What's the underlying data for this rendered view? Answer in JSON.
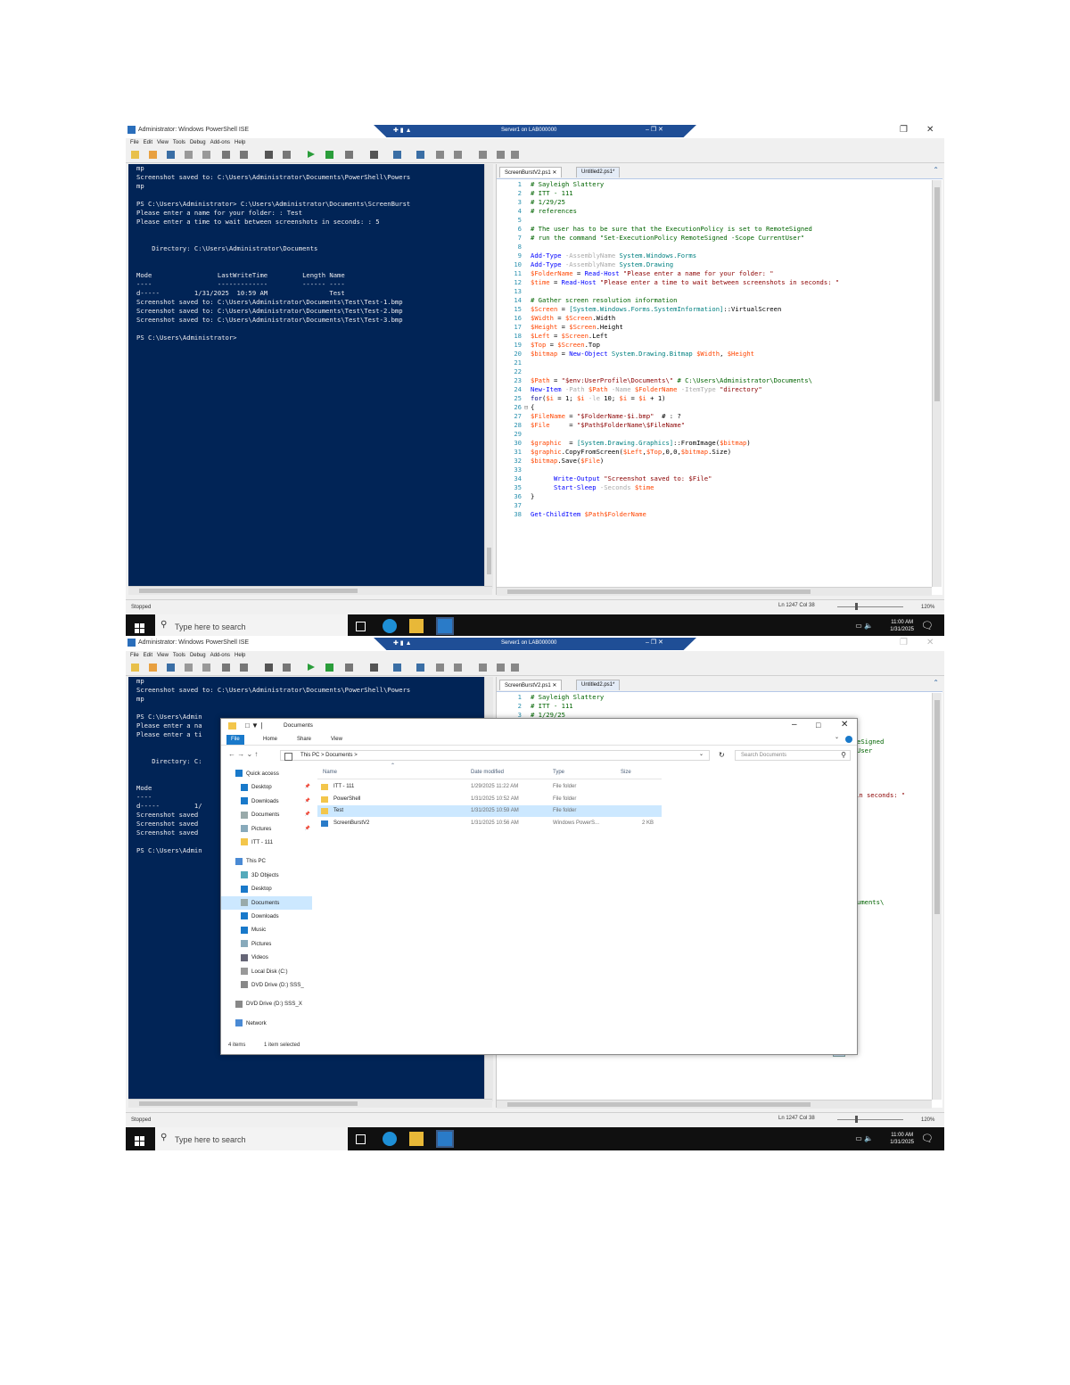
{
  "window": {
    "title": "Administrator: Windows PowerShell ISE",
    "menu": [
      "File",
      "Edit",
      "View",
      "Tools",
      "Debug",
      "Add-ons",
      "Help"
    ]
  },
  "rdp_bar": {
    "server": "Server1 on LAB000000"
  },
  "console_lines_top": [
    "mp",
    "Screenshot saved to: C:\\Users\\Administrator\\Documents\\PowerShell\\Powers",
    "mp",
    "",
    "PS C:\\Users\\Administrator> C:\\Users\\Administrator\\Documents\\ScreenBurst",
    "Please enter a name for your folder: : Test",
    "Please enter a time to wait between screenshots in seconds: : 5",
    "",
    "",
    "    Directory: C:\\Users\\Administrator\\Documents",
    "",
    "",
    "Mode                 LastWriteTime         Length Name",
    "----                 -------------         ------ ----",
    "d-----         1/31/2025  10:59 AM                Test",
    "Screenshot saved to: C:\\Users\\Administrator\\Documents\\Test\\Test-1.bmp",
    "Screenshot saved to: C:\\Users\\Administrator\\Documents\\Test\\Test-2.bmp",
    "Screenshot saved to: C:\\Users\\Administrator\\Documents\\Test\\Test-3.bmp",
    "",
    "PS C:\\Users\\Administrator>"
  ],
  "console_lines_bottom": [
    "mp",
    "Screenshot saved to: C:\\Users\\Administrator\\Documents\\PowerShell\\Powers",
    "mp",
    "",
    "PS C:\\Users\\Admin",
    "Please enter a na",
    "Please enter a ti",
    "",
    "",
    "    Directory: C:",
    "",
    "",
    "Mode",
    "----",
    "d-----         1/",
    "Screenshot saved",
    "Screenshot saved",
    "Screenshot saved",
    "",
    "PS C:\\Users\\Admin"
  ],
  "editor": {
    "tabs": [
      "ScreenBurstV2.ps1",
      "Untitled2.ps1*"
    ],
    "lines": [
      {
        "n": "1",
        "tokens": [
          [
            "c",
            "# Sayleigh Slattery"
          ]
        ]
      },
      {
        "n": "2",
        "tokens": [
          [
            "c",
            "# ITT - 111"
          ]
        ]
      },
      {
        "n": "3",
        "tokens": [
          [
            "c",
            "# 1/29/25"
          ]
        ]
      },
      {
        "n": "4",
        "tokens": [
          [
            "c",
            "# references"
          ]
        ]
      },
      {
        "n": "5",
        "tokens": []
      },
      {
        "n": "6",
        "tokens": [
          [
            "c",
            "# The user has to be sure that the ExecutionPolicy is set to RemoteSigned"
          ]
        ]
      },
      {
        "n": "7",
        "tokens": [
          [
            "c",
            "# run the command \"Set-ExecutionPolicy RemoteSigned -Scope CurrentUser\""
          ]
        ]
      },
      {
        "n": "8",
        "tokens": []
      },
      {
        "n": "9",
        "tokens": [
          [
            "k",
            "Add-Type"
          ],
          [
            "p",
            " "
          ],
          [
            "o",
            "-AssemblyName"
          ],
          [
            "p",
            " "
          ],
          [
            "t",
            "System.Windows.Forms"
          ]
        ]
      },
      {
        "n": "10",
        "tokens": [
          [
            "k",
            "Add-Type"
          ],
          [
            "p",
            " "
          ],
          [
            "o",
            "-AssemblyName"
          ],
          [
            "p",
            " "
          ],
          [
            "t",
            "System.Drawing"
          ]
        ]
      },
      {
        "n": "11",
        "tokens": [
          [
            "v",
            "$FolderName"
          ],
          [
            "p",
            " = "
          ],
          [
            "k",
            "Read-Host"
          ],
          [
            "p",
            " "
          ],
          [
            "s",
            "\"Please enter a name for your folder: \""
          ]
        ]
      },
      {
        "n": "12",
        "tokens": [
          [
            "v",
            "$time"
          ],
          [
            "p",
            " = "
          ],
          [
            "k",
            "Read-Host"
          ],
          [
            "p",
            " "
          ],
          [
            "s",
            "\"Please enter a time to wait between screenshots in seconds: \""
          ]
        ]
      },
      {
        "n": "13",
        "tokens": []
      },
      {
        "n": "14",
        "tokens": [
          [
            "c",
            "# Gather screen resolution information"
          ]
        ]
      },
      {
        "n": "15",
        "tokens": [
          [
            "v",
            "$Screen"
          ],
          [
            "p",
            " = "
          ],
          [
            "t",
            "[System.Windows.Forms.SystemInformation]"
          ],
          [
            "p",
            "::VirtualScreen"
          ]
        ]
      },
      {
        "n": "16",
        "tokens": [
          [
            "v",
            "$Width"
          ],
          [
            "p",
            " = "
          ],
          [
            "v",
            "$Screen"
          ],
          [
            "p",
            ".Width"
          ]
        ]
      },
      {
        "n": "17",
        "tokens": [
          [
            "v",
            "$Height"
          ],
          [
            "p",
            " = "
          ],
          [
            "v",
            "$Screen"
          ],
          [
            "p",
            ".Height"
          ]
        ]
      },
      {
        "n": "18",
        "tokens": [
          [
            "v",
            "$Left"
          ],
          [
            "p",
            " = "
          ],
          [
            "v",
            "$Screen"
          ],
          [
            "p",
            ".Left"
          ]
        ]
      },
      {
        "n": "19",
        "tokens": [
          [
            "v",
            "$Top"
          ],
          [
            "p",
            " = "
          ],
          [
            "v",
            "$Screen"
          ],
          [
            "p",
            ".Top"
          ]
        ]
      },
      {
        "n": "20",
        "tokens": [
          [
            "v",
            "$bitmap"
          ],
          [
            "p",
            " = "
          ],
          [
            "k",
            "New-Object"
          ],
          [
            "p",
            " "
          ],
          [
            "t",
            "System.Drawing.Bitmap"
          ],
          [
            "p",
            " "
          ],
          [
            "v",
            "$Width"
          ],
          [
            "p",
            ", "
          ],
          [
            "v",
            "$Height"
          ]
        ]
      },
      {
        "n": "21",
        "tokens": []
      },
      {
        "n": "22",
        "tokens": []
      },
      {
        "n": "23",
        "tokens": [
          [
            "v",
            "$Path"
          ],
          [
            "p",
            " = "
          ],
          [
            "s",
            "\"$env:UserProfile\\Documents\\\""
          ],
          [
            "p",
            " "
          ],
          [
            "c",
            "# C:\\Users\\Administrator\\Documents\\"
          ]
        ]
      },
      {
        "n": "24",
        "tokens": [
          [
            "k",
            "New-Item"
          ],
          [
            "p",
            " "
          ],
          [
            "o",
            "-Path"
          ],
          [
            "p",
            " "
          ],
          [
            "v",
            "$Path"
          ],
          [
            "p",
            " "
          ],
          [
            "o",
            "-Name"
          ],
          [
            "p",
            " "
          ],
          [
            "v",
            "$FolderName"
          ],
          [
            "p",
            " "
          ],
          [
            "o",
            "-ItemType"
          ],
          [
            "p",
            " "
          ],
          [
            "s",
            "\"directory\""
          ]
        ]
      },
      {
        "n": "25",
        "tokens": [
          [
            "w",
            "for"
          ],
          [
            "p",
            "("
          ],
          [
            "v",
            "$i"
          ],
          [
            "p",
            " = 1; "
          ],
          [
            "v",
            "$i"
          ],
          [
            "p",
            " "
          ],
          [
            "o",
            "-le"
          ],
          [
            "p",
            " 10; "
          ],
          [
            "v",
            "$i"
          ],
          [
            "p",
            " = "
          ],
          [
            "v",
            "$i"
          ],
          [
            "p",
            " + 1)"
          ]
        ]
      },
      {
        "n": "26",
        "tokens": [
          [
            "p",
            "{"
          ]
        ],
        "fold": true
      },
      {
        "n": "27",
        "tokens": [
          [
            "v",
            "$FileName"
          ],
          [
            "p",
            " = "
          ],
          [
            "s",
            "\"$FolderName-$i.bmp\""
          ],
          [
            "p",
            "  # : ?"
          ]
        ]
      },
      {
        "n": "28",
        "tokens": [
          [
            "v",
            "$File"
          ],
          [
            "p",
            "     = "
          ],
          [
            "s",
            "\"$Path$FolderName\\$FileName\""
          ]
        ]
      },
      {
        "n": "29",
        "tokens": []
      },
      {
        "n": "30",
        "tokens": [
          [
            "v",
            "$graphic"
          ],
          [
            "p",
            "  = "
          ],
          [
            "t",
            "[System.Drawing.Graphics]"
          ],
          [
            "p",
            "::FromImage("
          ],
          [
            "v",
            "$bitmap"
          ],
          [
            "p",
            ")"
          ]
        ]
      },
      {
        "n": "31",
        "tokens": [
          [
            "v",
            "$graphic"
          ],
          [
            "p",
            ".CopyFromScreen("
          ],
          [
            "v",
            "$Left"
          ],
          [
            "p",
            ","
          ],
          [
            "v",
            "$Top"
          ],
          [
            "p",
            ",0,0,"
          ],
          [
            "v",
            "$bitmap"
          ],
          [
            "p",
            ".Size)"
          ]
        ]
      },
      {
        "n": "32",
        "tokens": [
          [
            "v",
            "$bitmap"
          ],
          [
            "p",
            ".Save("
          ],
          [
            "v",
            "$File"
          ],
          [
            "p",
            ")"
          ]
        ]
      },
      {
        "n": "33",
        "tokens": []
      },
      {
        "n": "34",
        "tokens": [
          [
            "p",
            "      "
          ],
          [
            "k",
            "Write-Output"
          ],
          [
            "p",
            " "
          ],
          [
            "s",
            "\"Screenshot saved to: $File\""
          ]
        ]
      },
      {
        "n": "35",
        "tokens": [
          [
            "p",
            "      "
          ],
          [
            "k",
            "Start-Sleep"
          ],
          [
            "p",
            " "
          ],
          [
            "o",
            "-Seconds"
          ],
          [
            "p",
            " "
          ],
          [
            "v",
            "$time"
          ]
        ]
      },
      {
        "n": "36",
        "tokens": [
          [
            "p",
            "}"
          ]
        ]
      },
      {
        "n": "37",
        "tokens": []
      },
      {
        "n": "38",
        "tokens": [
          [
            "k",
            "Get-ChildItem"
          ],
          [
            "p",
            " "
          ],
          [
            "v",
            "$Path$FolderName"
          ]
        ]
      }
    ],
    "bottom_visible_lines": 3,
    "bottom_fragments": [
      {
        "text": "eSigned",
        "row": 5
      },
      {
        "text": "User",
        "row": 6
      },
      {
        "text": "in seconds: \"",
        "row": 11
      },
      {
        "text": "uments\\",
        "row": 23
      }
    ]
  },
  "status": {
    "state": "Stopped",
    "position": "Ln 1247  Col 38",
    "zoom": "120%"
  },
  "taskbar": {
    "search_placeholder": "Type here to search",
    "time": "11:00 AM",
    "date": "1/31/2025"
  },
  "explorer": {
    "title": "Documents",
    "ribbon_tabs": [
      "File",
      "Home",
      "Share",
      "View"
    ],
    "breadcrumb": "This PC  >  Documents  >",
    "search_placeholder": "Search Documents",
    "nav": [
      {
        "label": "Quick access",
        "indent": 0,
        "icon": "star-icon"
      },
      {
        "label": "Desktop",
        "indent": 1,
        "icon": "desktop-icon"
      },
      {
        "label": "Downloads",
        "indent": 1,
        "icon": "download-icon"
      },
      {
        "label": "Documents",
        "indent": 1,
        "icon": "document-icon"
      },
      {
        "label": "Pictures",
        "indent": 1,
        "icon": "pictures-icon"
      },
      {
        "label": "ITT - 111",
        "indent": 1,
        "icon": "folder-icon"
      },
      {
        "label": "This PC",
        "indent": 0,
        "icon": "pc-icon"
      },
      {
        "label": "3D Objects",
        "indent": 1,
        "icon": "objects-icon"
      },
      {
        "label": "Desktop",
        "indent": 1,
        "icon": "desktop-icon"
      },
      {
        "label": "Documents",
        "indent": 1,
        "icon": "document-icon",
        "selected": true
      },
      {
        "label": "Downloads",
        "indent": 1,
        "icon": "download-icon"
      },
      {
        "label": "Music",
        "indent": 1,
        "icon": "music-icon"
      },
      {
        "label": "Pictures",
        "indent": 1,
        "icon": "pictures-icon"
      },
      {
        "label": "Videos",
        "indent": 1,
        "icon": "video-icon"
      },
      {
        "label": "Local Disk (C:)",
        "indent": 1,
        "icon": "disk-icon"
      },
      {
        "label": "DVD Drive (D:) SSS_",
        "indent": 1,
        "icon": "dvd-icon"
      },
      {
        "label": "DVD Drive (D:) SSS_X",
        "indent": 0,
        "icon": "dvd-icon"
      },
      {
        "label": "Network",
        "indent": 0,
        "icon": "network-icon"
      }
    ],
    "columns": [
      "Name",
      "Date modified",
      "Type",
      "Size"
    ],
    "files": [
      {
        "name": "ITT - 111",
        "date": "1/29/2025 11:22 AM",
        "type": "File folder",
        "size": "",
        "icon": "folder"
      },
      {
        "name": "PowerShell",
        "date": "1/31/2025 10:52 AM",
        "type": "File folder",
        "size": "",
        "icon": "folder"
      },
      {
        "name": "Test",
        "date": "1/31/2025 10:59 AM",
        "type": "File folder",
        "size": "",
        "icon": "folder",
        "selected": true
      },
      {
        "name": "ScreenBurstV2",
        "date": "1/31/2025 10:56 AM",
        "type": "Windows PowerS...",
        "size": "2 KB",
        "icon": "script"
      }
    ],
    "status_items": "4 items",
    "status_selected": "1 item selected"
  },
  "colors": {
    "console_bg": "#012456",
    "rdp_bar": "#1f4e96",
    "explorer_file_tab": "#1979ca",
    "selection": "#cce8ff"
  }
}
